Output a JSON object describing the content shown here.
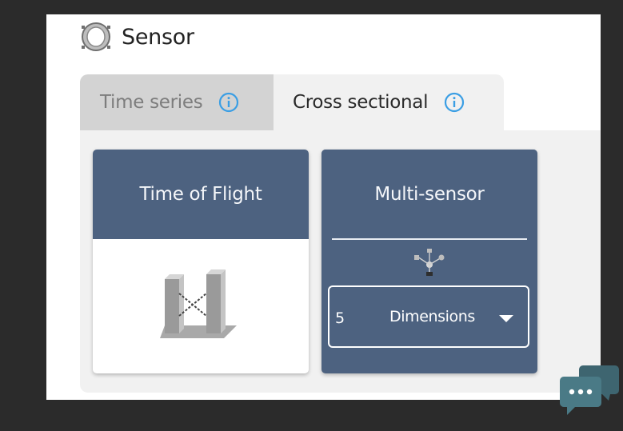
{
  "header": {
    "title": "Sensor",
    "icon": "sensor-ring-icon"
  },
  "tabs": [
    {
      "label": "Time series",
      "icon": "info-icon",
      "active": false
    },
    {
      "label": "Cross sectional",
      "icon": "info-icon",
      "active": true
    }
  ],
  "cards": {
    "time_of_flight": {
      "title": "Time of Flight",
      "icon": "time-of-flight-icon"
    },
    "multi_sensor": {
      "title": "Multi-sensor",
      "icon": "multi-sensor-icon",
      "dimensions_select": {
        "value": "5",
        "label": "Dimensions",
        "icon": "caret-down-icon"
      }
    }
  },
  "chat_widget": {
    "icon": "chat-bubbles-icon"
  },
  "colors": {
    "background": "#2b2b2b",
    "panel": "#ffffff",
    "card_header": "#4d6280",
    "tab_inactive": "#d3d3d3",
    "tab_active": "#f1f1f1",
    "info_blue": "#3a9ee4",
    "chat_widget": "#3e6570"
  }
}
